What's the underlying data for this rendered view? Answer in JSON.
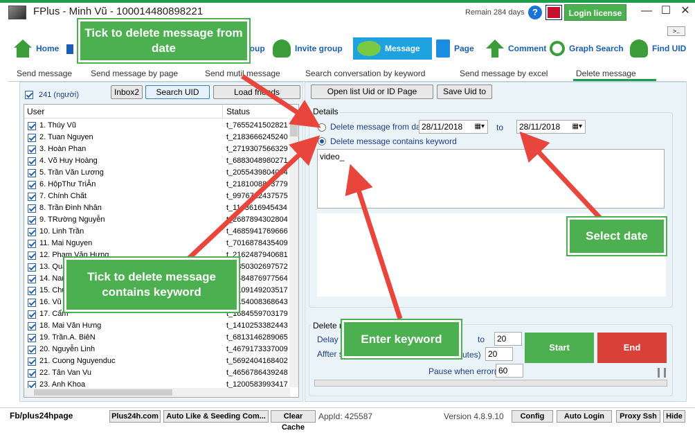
{
  "app": {
    "title": "FPlus - Minh Vũ - 100014480898221",
    "remain": "Remain 284 days",
    "help": "?",
    "login": "Login license",
    "more": ">..",
    "min": "—",
    "max": "☐",
    "close": "✕"
  },
  "nav": [
    {
      "label": "Home"
    },
    {
      "label": "roup"
    },
    {
      "label": "Invite group"
    },
    {
      "label": "Message"
    },
    {
      "label": "Page"
    },
    {
      "label": "Comment"
    },
    {
      "label": "Graph Search"
    },
    {
      "label": "Find UID"
    }
  ],
  "tabs": [
    "Send message",
    "Send message by page",
    "Send mutil message",
    "Search conversation by keyword",
    "Send message by excel",
    "Delete message"
  ],
  "left": {
    "count": "241 (người)",
    "buttons": {
      "inbox2": "Inbox2",
      "search_uid": "Search UID",
      "load": "Load friends"
    },
    "headers": {
      "user": "User",
      "status": "Status"
    },
    "rows": [
      {
        "name": "1. Thúy Vũ",
        "status": "t_7655241502821"
      },
      {
        "name": "2. Tuan Nguyen",
        "status": "t_2183666245240"
      },
      {
        "name": "3. Hoàn Phan",
        "status": "t_2719307566329"
      },
      {
        "name": "4. Võ Huy Hoàng",
        "status": "t_6883048980271"
      },
      {
        "name": "5. Trần Văn Lương",
        "status": "t_2055439804054"
      },
      {
        "name": "6. HộpThư TriÂn",
        "status": "t_2181008893779"
      },
      {
        "name": "7. Chính Chất",
        "status": "t_9976712437575"
      },
      {
        "name": "8. Trần Đình Nhân",
        "status": "t_1143616945434"
      },
      {
        "name": "9. TRường Nguyễn",
        "status": "t_2687894302804"
      },
      {
        "name": "10. Linh Trần",
        "status": "t_4685941769666"
      },
      {
        "name": "11. Mai Nguyen",
        "status": "t_7016878435409"
      },
      {
        "name": "12. Pham Văn Hưng",
        "status": "t_2162487940681"
      },
      {
        "name": "13. Quang",
        "status": "t_1850302697572"
      },
      {
        "name": "14. Nam",
        "status": "t_8484876977564"
      },
      {
        "name": "15. Chu",
        "status": "t_8109149203517"
      },
      {
        "name": "16. Vũ",
        "status": "t_7154008368643"
      },
      {
        "name": "17. Cẩm",
        "status": "t_1684559703179"
      },
      {
        "name": "18. Mai Văn Hưng",
        "status": "t_1410253382443"
      },
      {
        "name": "19. Trần.A. BiêN",
        "status": "t_6813146289065"
      },
      {
        "name": "20. Nguyễn Linh",
        "status": "t_4679173337009"
      },
      {
        "name": "21. Cuong Nguyenduc",
        "status": "t_5692404168402"
      },
      {
        "name": "22. Tân Van Vu",
        "status": "t_4656786439248"
      },
      {
        "name": "23. Anh Khoa",
        "status": "t_1200583993417"
      }
    ]
  },
  "right": {
    "buttons": {
      "open_list": "Open list Uid or ID Page",
      "save_uid": "Save Uid to"
    },
    "details_label": "Details",
    "opt_date": "Delete message from date",
    "date_from": "28/11/2018",
    "to_label": "to",
    "date_to": "28/11/2018",
    "opt_keyword": "Delete message contains keyword",
    "keyword": "video_",
    "delete_group_label": "Delete m",
    "delay_label": "Delay f",
    "delay_to": "to",
    "delay_value": "20",
    "after_label": "Affter s",
    "after_suffix": "utes)",
    "after_value": "20",
    "pause_label": "Pause when error(m)",
    "pause_value": "60",
    "start": "Start",
    "end": "End"
  },
  "status": {
    "fb": "Fb/plus24hpage",
    "plus24h": "Plus24h.com",
    "auto_like": "Auto Like & Seeding Com...",
    "clear_cache": "Clear Cache",
    "appid": "AppId: 425587",
    "version": "Version 4.8.9.10",
    "config": "Config",
    "auto_login": "Auto Login",
    "proxy": "Proxy Ssh",
    "hide": "Hide"
  },
  "callouts": {
    "from_date": "Tick to delete message from date",
    "select_date": "Select date",
    "contains_keyword": "Tick to delete message contains keyword",
    "enter_keyword": "Enter keyword"
  },
  "colors": {
    "accent_green": "#4caf50",
    "arrow_red": "#e8453c",
    "tab_blue": "#1fa2e0",
    "end_red": "#d9403a"
  }
}
